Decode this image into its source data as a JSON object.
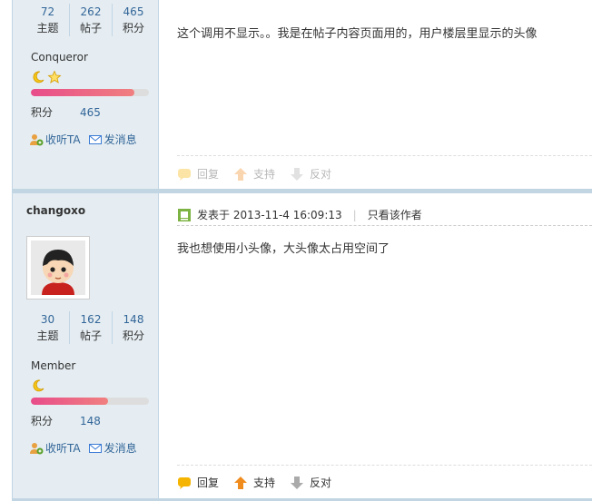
{
  "post1": {
    "stats": [
      {
        "num": "72",
        "label": "主题"
      },
      {
        "num": "262",
        "label": "帖子"
      },
      {
        "num": "465",
        "label": "积分"
      }
    ],
    "rank": "Conqueror",
    "progress_fraction": 0.88,
    "points_label": "积分",
    "points_value": "465",
    "follow_label": "收听TA",
    "message_label": "发消息",
    "text": "这个调用不显示。。我是在帖子内容页面用的，用户楼层里显示的头像",
    "footer": {
      "reply": "回复",
      "support": "支持",
      "oppose": "反对"
    }
  },
  "post2": {
    "username": "changoxo",
    "stats": [
      {
        "num": "30",
        "label": "主题"
      },
      {
        "num": "162",
        "label": "帖子"
      },
      {
        "num": "148",
        "label": "积分"
      }
    ],
    "rank": "Member",
    "progress_fraction": 0.65,
    "points_label": "积分",
    "points_value": "148",
    "follow_label": "收听TA",
    "message_label": "发消息",
    "posted_at": "发表于 2013-11-4 16:09:13",
    "author_only": "只看该作者",
    "text": "我也想使用小头像，大头像太占用空间了",
    "footer": {
      "reply": "回复",
      "support": "支持",
      "oppose": "反对"
    }
  },
  "colors": {
    "accent": "#336699",
    "border": "#c2d5e3",
    "sidebar_bg": "#e5edf2"
  },
  "icons": [
    "moon-icon",
    "star-icon",
    "follow-icon",
    "envelope-icon",
    "post-icon",
    "reply-bubble-icon",
    "support-arrow-icon",
    "oppose-arrow-icon"
  ]
}
